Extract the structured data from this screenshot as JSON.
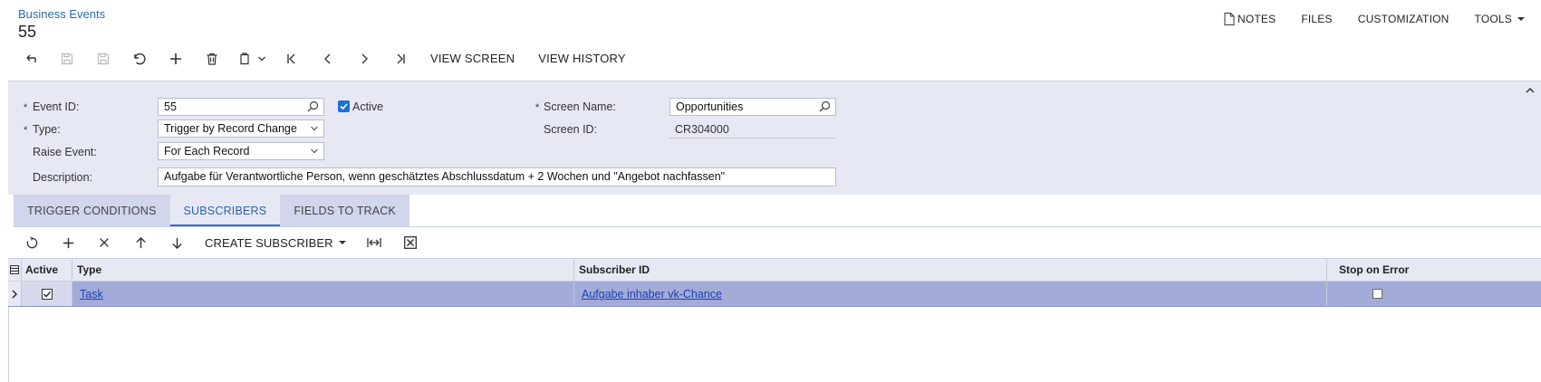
{
  "header": {
    "breadcrumb": "Business Events",
    "record_title": "55",
    "links": {
      "notes": "NOTES",
      "files": "FILES",
      "customization": "CUSTOMIZATION",
      "tools": "TOOLS"
    }
  },
  "toolbar": {
    "view_screen": "VIEW SCREEN",
    "view_history": "VIEW HISTORY"
  },
  "form": {
    "event_id_label": "Event ID:",
    "event_id_value": "55",
    "active_label": "Active",
    "active_checked": true,
    "type_label": "Type:",
    "type_value": "Trigger by Record Change",
    "raise_event_label": "Raise Event:",
    "raise_event_value": "For Each Record",
    "description_label": "Description:",
    "description_value": "Aufgabe für Verantwortliche Person, wenn geschätztes Abschlussdatum + 2 Wochen und \"Angebot nachfassen\"",
    "screen_name_label": "Screen Name:",
    "screen_name_value": "Opportunities",
    "screen_id_label": "Screen ID:",
    "screen_id_value": "CR304000",
    "required_mark": "*"
  },
  "tabs": [
    {
      "label": "TRIGGER CONDITIONS",
      "active": false
    },
    {
      "label": "SUBSCRIBERS",
      "active": true
    },
    {
      "label": "FIELDS TO TRACK",
      "active": false
    }
  ],
  "grid_toolbar": {
    "create_subscriber": "CREATE SUBSCRIBER"
  },
  "grid": {
    "columns": {
      "active": "Active",
      "type": "Type",
      "subscriber_id": "Subscriber ID",
      "stop_on_error": "Stop on Error"
    },
    "rows": [
      {
        "active": true,
        "type": "Task",
        "subscriber_id": "Aufgabe inhaber vk-Chance",
        "stop_on_error": false
      }
    ]
  },
  "colors": {
    "link": "#2a6ab8",
    "panel_bg": "#e6e9f4",
    "tab_active": "#2d5fb5",
    "selected_row": "#a3abd9",
    "checkbox_blue": "#1e6fd9"
  }
}
